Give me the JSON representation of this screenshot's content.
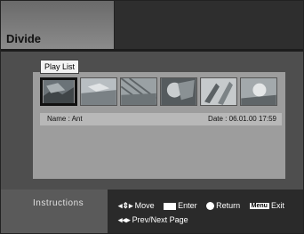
{
  "header": {
    "title": "Divide"
  },
  "playlist": {
    "tab_label": "Play List",
    "thumbnails": [
      {
        "name": "thumbnail-1",
        "icon": "scene-photo",
        "selected": true
      },
      {
        "name": "thumbnail-2",
        "icon": "scene-photo",
        "selected": false
      },
      {
        "name": "thumbnail-3",
        "icon": "scene-photo",
        "selected": false
      },
      {
        "name": "thumbnail-4",
        "icon": "scene-photo",
        "selected": false
      },
      {
        "name": "thumbnail-5",
        "icon": "scene-photo",
        "selected": false
      },
      {
        "name": "thumbnail-6",
        "icon": "scene-photo",
        "selected": false
      }
    ]
  },
  "info": {
    "name": "Name : Ant",
    "date": "Date :  06.01.00  17:59"
  },
  "instructions": {
    "title": "Instructions",
    "move_label": "Move",
    "enter_label": "Enter",
    "return_label": "Return",
    "menu_key": "Menu",
    "exit_label": "Exit",
    "page_label": "Prev/Next Page"
  },
  "colors": {
    "background": "#4e4e4e",
    "panel": "#9d9d9d",
    "info_bar": "#b8b8b8"
  }
}
